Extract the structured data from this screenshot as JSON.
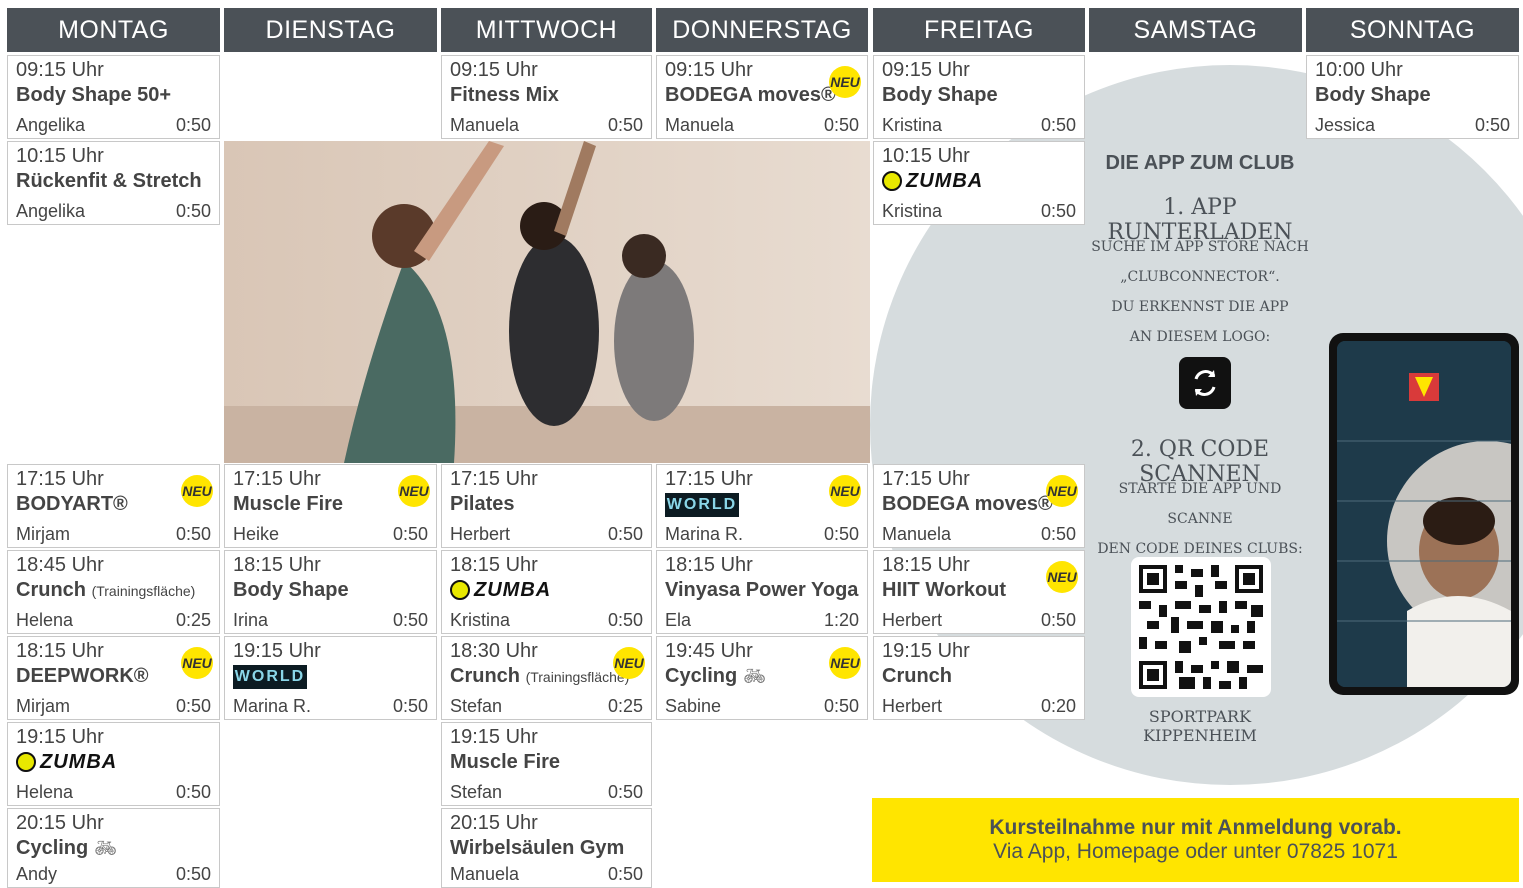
{
  "days": [
    "MONTAG",
    "DIENSTAG",
    "MITTWOCH",
    "DONNERSTAG",
    "FREITAG",
    "SAMSTAG",
    "SONNTAG"
  ],
  "neu_label": "NEU",
  "minus": "",
  "zumba_word": "ZUMBA",
  "world_word": "WORLD",
  "courses": {
    "mo1": {
      "time": "09:15 Uhr",
      "title": "Body Shape 50+",
      "trainer": "Angelika",
      "duration": "0:50"
    },
    "mo2": {
      "time": "10:15 Uhr",
      "title": "Rückenfit & Stretch",
      "trainer": "Angelika",
      "duration": "0:50"
    },
    "mo3": {
      "time": "17:15 Uhr",
      "title": "BODYART®",
      "trainer": "Mirjam",
      "duration": "0:50"
    },
    "mo4": {
      "time": "18:45 Uhr",
      "title": "Crunch",
      "sub": "(Trainingsfläche)",
      "trainer": "Helena",
      "duration": "0:25"
    },
    "mo5": {
      "time": "18:15 Uhr",
      "title": "DEEPWORK®",
      "trainer": "Mirjam",
      "duration": "0:50"
    },
    "mo6": {
      "time": "19:15 Uhr",
      "trainer": "Helena",
      "duration": "0:50"
    },
    "mo7": {
      "time": "20:15 Uhr",
      "title": "Cycling",
      "trainer": "Andy",
      "duration": "0:50"
    },
    "di1": {
      "time": "17:15 Uhr",
      "title": "Muscle Fire",
      "trainer": "Heike",
      "duration": "0:50"
    },
    "di2": {
      "time": "18:15 Uhr",
      "title": "Body Shape",
      "trainer": "Irina",
      "duration": "0:50"
    },
    "di3": {
      "time": "19:15 Uhr",
      "trainer": "Marina R.",
      "duration": "0:50"
    },
    "mi1": {
      "time": "09:15 Uhr",
      "title": "Fitness Mix",
      "trainer": "Manuela",
      "duration": "0:50"
    },
    "mi2": {
      "time": "17:15 Uhr",
      "title": "Pilates",
      "trainer": "Herbert",
      "duration": "0:50"
    },
    "mi3": {
      "time": "18:15 Uhr",
      "trainer": "Kristina",
      "duration": "0:50"
    },
    "mi4": {
      "time": "18:30 Uhr",
      "title": "Crunch",
      "sub": "(Trainingsfläche)",
      "trainer": "Stefan",
      "duration": "0:25"
    },
    "mi5": {
      "time": "19:15 Uhr",
      "title": "Muscle Fire",
      "trainer": "Stefan",
      "duration": "0:50"
    },
    "mi6": {
      "time": "20:15 Uhr",
      "title": "Wirbelsäulen Gym",
      "trainer": "Manuela",
      "duration": "0:50"
    },
    "do1": {
      "time": "09:15 Uhr",
      "title": "BODEGA moves®",
      "trainer": "Manuela",
      "duration": "0:50"
    },
    "do2": {
      "time": "17:15 Uhr",
      "trainer": "Marina R.",
      "duration": "0:50"
    },
    "do3": {
      "time": "18:15 Uhr",
      "title": "Vinyasa Power Yoga",
      "trainer": "Ela",
      "duration": "1:20"
    },
    "do4": {
      "time": "19:45 Uhr",
      "title": "Cycling",
      "trainer": "Sabine",
      "duration": "0:50"
    },
    "fr1": {
      "time": "09:15 Uhr",
      "title": "Body Shape",
      "trainer": "Kristina",
      "duration": "0:50"
    },
    "fr2": {
      "time": "10:15 Uhr",
      "trainer": "Kristina",
      "duration": "0:50"
    },
    "fr3": {
      "time": "17:15 Uhr",
      "title": "BODEGA moves®",
      "trainer": "Manuela",
      "duration": "0:50"
    },
    "fr4": {
      "time": "18:15 Uhr",
      "title": "HIIT Workout",
      "trainer": "Herbert",
      "duration": "0:50"
    },
    "fr5": {
      "time": "19:15 Uhr",
      "title": "Crunch",
      "trainer": "Herbert",
      "duration": "0:20"
    },
    "so1": {
      "time": "10:00 Uhr",
      "title": "Body Shape",
      "trainer": "Jessica",
      "duration": "0:50"
    }
  },
  "app": {
    "heading": "DIE APP ZUM CLUB",
    "step1_title": "1. APP RUNTERLADEN",
    "step1_text": [
      "SUCHE IM APP STORE NACH",
      "„CLUBCONNECTOR“.",
      "DU ERKENNST DIE APP",
      "AN DIESEM LOGO:"
    ],
    "step2_title": "2. QR CODE SCANNEN",
    "step2_text": [
      "STARTE DIE APP UND SCANNE",
      "DEN CODE DEINES CLUBS:"
    ],
    "club_name": "SPORTPARK KIPPENHEIM"
  },
  "notice": {
    "line1": "Kursteilnahme nur mit Anmeldung vorab.",
    "line2": "Via App, Homepage oder unter 07825 1071"
  },
  "colors": {
    "header_bg": "#4b5157",
    "accent_yellow": "#ffe500",
    "circle_bg": "#d6dcde"
  }
}
